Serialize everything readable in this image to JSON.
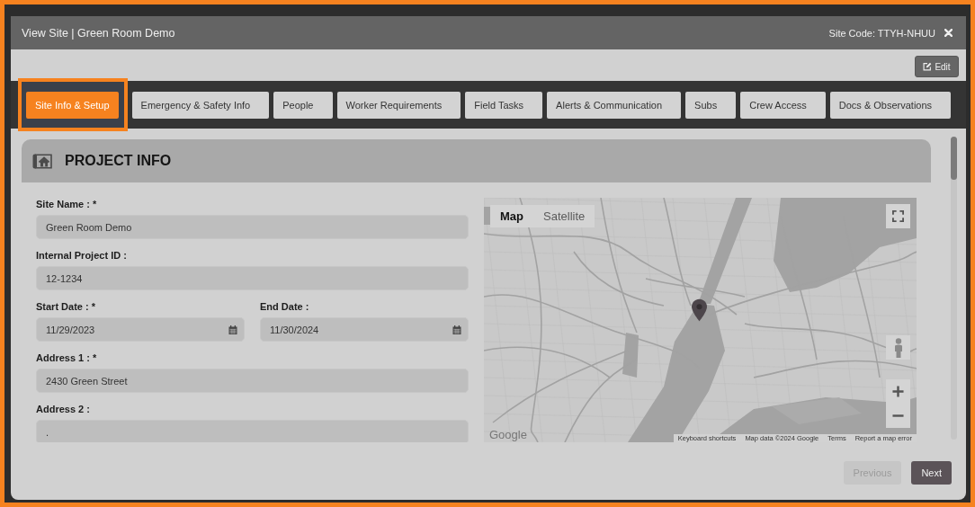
{
  "window": {
    "title": "View Site | Green Room Demo",
    "site_code": "Site Code: TTYH-NHUU"
  },
  "toolbar": {
    "edit_label": "Edit"
  },
  "tabs": [
    {
      "label": "Site Info & Setup",
      "selected": true,
      "highlighted": true
    },
    {
      "label": "Emergency & Safety Info",
      "selected": false,
      "highlighted": false
    },
    {
      "label": "People",
      "selected": false,
      "highlighted": false
    },
    {
      "label": "Worker Requirements",
      "selected": false,
      "highlighted": false
    },
    {
      "label": "Field Tasks",
      "selected": false,
      "highlighted": false
    },
    {
      "label": "Alerts & Communication",
      "selected": false,
      "highlighted": false
    },
    {
      "label": "Subs",
      "selected": false,
      "highlighted": false
    },
    {
      "label": "Crew Access",
      "selected": false,
      "highlighted": false
    },
    {
      "label": "Docs & Observations",
      "selected": false,
      "highlighted": false
    }
  ],
  "section": {
    "title": "PROJECT INFO"
  },
  "form": {
    "rows": [
      {
        "fields": [
          {
            "label": "Site Name : *",
            "value": "Green Room Demo",
            "kind": "text"
          }
        ]
      },
      {
        "fields": [
          {
            "label": "Internal Project ID :",
            "value": "12-1234",
            "kind": "text"
          }
        ]
      },
      {
        "fields": [
          {
            "label": "Start Date : *",
            "value": "11/29/2023",
            "kind": "date"
          },
          {
            "label": "End Date :",
            "value": "11/30/2024",
            "kind": "date"
          }
        ]
      },
      {
        "fields": [
          {
            "label": "Address 1 : *",
            "value": "2430 Green Street",
            "kind": "text"
          }
        ]
      },
      {
        "fields": [
          {
            "label": "Address 2 :",
            "value": ".",
            "kind": "text"
          }
        ]
      }
    ]
  },
  "map": {
    "map_types": [
      {
        "label": "Map",
        "selected": true
      },
      {
        "label": "Satellite",
        "selected": false
      }
    ],
    "logo": "Google",
    "attribution": [
      "Keyboard shortcuts",
      "Map data ©2024 Google",
      "Terms",
      "Report a map error"
    ]
  },
  "footer": {
    "buttons": [
      {
        "label": "Previous",
        "disabled": true
      },
      {
        "label": "Next",
        "disabled": false
      }
    ]
  }
}
